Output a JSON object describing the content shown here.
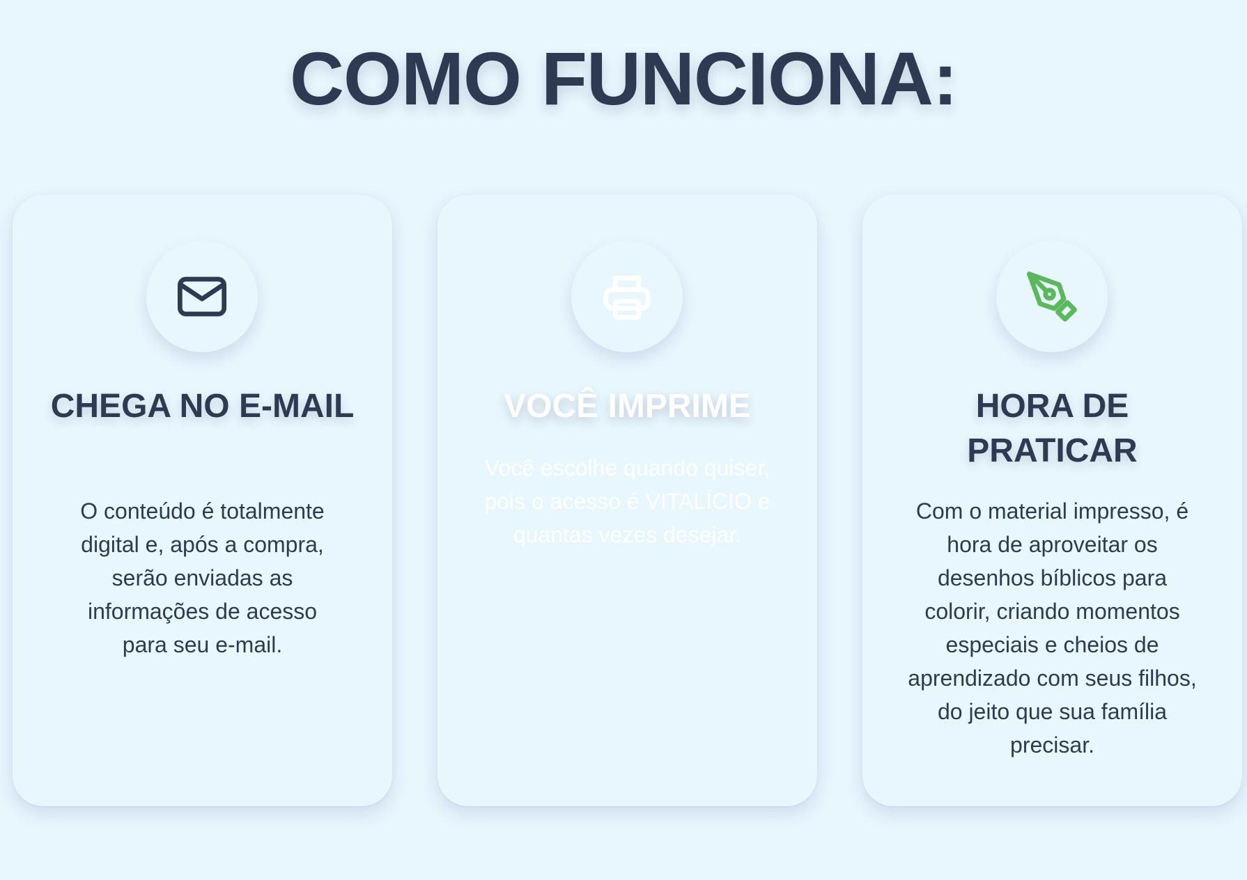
{
  "page": {
    "title": "COMO FUNCIONA:"
  },
  "colors": {
    "background": "#e8f6fe",
    "text_dark": "#2d3a52",
    "text_light": "#ffffff",
    "accent_green": "#5cb85c"
  },
  "cards": [
    {
      "icon": "mail-icon",
      "title": "CHEGA NO E-MAIL",
      "text": "O conteúdo é totalmente digital e, após a compra, serão enviadas as informações de acesso para seu e-mail."
    },
    {
      "icon": "printer-icon",
      "title": "VOCÊ IMPRIME",
      "text": "Você escolhe quando quiser, pois o acesso é VITALÍCIO e quantas vezes desejar."
    },
    {
      "icon": "pen-tool-icon",
      "title": "HORA DE PRATICAR",
      "text": "Com o material impresso, é hora de aproveitar os desenhos bíblicos para colorir, criando momentos especiais e cheios de aprendizado com seus filhos, do jeito que sua família precisar."
    }
  ]
}
